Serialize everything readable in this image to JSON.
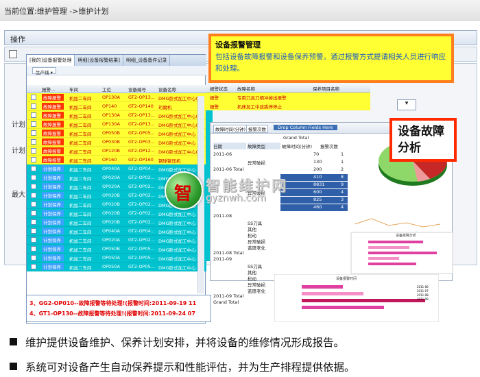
{
  "breadcrumb": "当前位置:维护管理 ->维护计划",
  "operations": {
    "label": "操作"
  },
  "left_labels": [
    "计划",
    "计划",
    "最大"
  ],
  "grid": {
    "tabs": [
      "[我的]设备报警处理",
      "明细[设备报警结果]",
      "明细_设备备件记录"
    ],
    "toolbar_button": "生产线 ▾",
    "headers": [
      "报警...",
      "车间",
      "工位",
      "设备编号",
      "设备名称",
      "报警状态",
      "故障名称",
      "保养项目名称"
    ],
    "rows": [
      {
        "type": "alarm",
        "tag": "故障报警",
        "workshop": "机加二车间",
        "station": "OP130A",
        "device_no": "GT2-OP13...",
        "device_name": "DMG卧式加工中心(精)"
      },
      {
        "type": "alarm",
        "tag": "故障报警",
        "workshop": "机加二车间",
        "station": "OP140",
        "device_no": "GT2-OP140",
        "device_name": "珩磨机"
      },
      {
        "type": "alarm",
        "tag": "故障报警",
        "workshop": "机加二车间",
        "station": "OP130A",
        "device_no": "GT2-OP13...",
        "device_name": "DMG卧式加工中心(精)"
      },
      {
        "type": "alarm",
        "tag": "故障报警",
        "workshop": "机加二车间",
        "station": "OP130A",
        "device_no": "GT2-OP13...",
        "device_name": "DMG卧式加工中心(精)"
      },
      {
        "type": "alarm",
        "tag": "故障报警",
        "workshop": "机加二车间",
        "station": "OP050B",
        "device_no": "GT2-OP05...",
        "device_name": "DMG卧式加工中心"
      },
      {
        "type": "alarm",
        "tag": "故障报警",
        "workshop": "机加二车间",
        "station": "OP030B",
        "device_no": "GT2-OP03...",
        "device_name": "DMG卧式加工中心"
      },
      {
        "type": "alarm",
        "tag": "故障报警",
        "workshop": "机加二车间",
        "station": "OP120B",
        "device_no": "GT2-OP12...",
        "device_name": "DMG卧式加工中心(精)"
      },
      {
        "type": "alarm",
        "tag": "故障报警",
        "workshop": "机加二车间",
        "station": "OP160",
        "device_no": "GT2-OP160",
        "device_name": "钢球铆压机"
      },
      {
        "type": "plan",
        "tag": "计划保养",
        "workshop": "机加二车间",
        "station": "OP040A",
        "device_no": "GT2-OP04...",
        "device_name": "DMG卧式加工中心"
      },
      {
        "type": "plan",
        "tag": "计划保养",
        "workshop": "机加二车间",
        "station": "OP020A",
        "device_no": "GT2-OP02...",
        "device_name": "DMG卧式加工中心"
      },
      {
        "type": "plan",
        "tag": "计划保养",
        "workshop": "机加二车间",
        "station": "OP020A",
        "device_no": "GT2-OP02...",
        "device_name": "DMG卧式加工中心"
      },
      {
        "type": "plan",
        "tag": "计划保养",
        "workshop": "机加二车间",
        "station": "OP020B",
        "device_no": "GT2-OP02...",
        "device_name": "DMG卧式加工中心"
      },
      {
        "type": "plan",
        "tag": "计划保养",
        "workshop": "机加二车间",
        "station": "OP020B",
        "device_no": "GT2-OP02...",
        "device_name": "DMG卧式加工中心"
      },
      {
        "type": "plan",
        "tag": "计划保养",
        "workshop": "机加二车间",
        "station": "OP020B",
        "device_no": "GT2-OP02...",
        "device_name": "DMG卧式加工中心"
      },
      {
        "type": "plan",
        "tag": "计划保养",
        "workshop": "机加二车间",
        "station": "OP020B",
        "device_no": "GT2-OP02...",
        "device_name": "DMG卧式加工中心"
      },
      {
        "type": "plan",
        "tag": "计划保养",
        "workshop": "机加二车间",
        "station": "OP040A",
        "device_no": "GT2-OP04...",
        "device_name": "DMG卧式加工中心"
      },
      {
        "type": "plan",
        "tag": "计划保养",
        "workshop": "机加二车间",
        "station": "OP020A",
        "device_no": "GT2-OP02...",
        "device_name": "DMG卧式加工中心"
      },
      {
        "type": "plan",
        "tag": "计划保养",
        "workshop": "机加二车间",
        "station": "OP050B",
        "device_no": "GT2-OP05...",
        "device_name": "DMG卧式加工中心"
      },
      {
        "type": "plan",
        "tag": "计划保养",
        "workshop": "机加二车间",
        "station": "OP050A",
        "device_no": "GT2-OP05...",
        "device_name": "DMG卧式加工中心"
      },
      {
        "type": "plan",
        "tag": "计划保养",
        "workshop": "机加二车间",
        "station": "OP050A",
        "device_no": "GT2-OP05...",
        "device_name": "DMG卧式加工中心"
      }
    ],
    "ext_rows": [
      {
        "status": "报警",
        "fault": "专用刀具刀柄冲掉出报警"
      },
      {
        "status": "报警",
        "fault": "机床加工中途跳停停止"
      }
    ]
  },
  "alarm_messages": [
    "3、GG2-OP010--故障报警等待处理!(报警时间:2011-09-19 11",
    "4、GT1-OP130--故障报警等待处理!(报警时间:2011-09-24 07"
  ],
  "callout_alarm": {
    "title": "设备报警管理",
    "desc": "包括设备故障报警和设备保养预警。通过报警方式提请相关人员进行响应和处理。"
  },
  "callout_analysis": {
    "line1": "设备故障",
    "line2": "分析"
  },
  "report": {
    "filter_buttons": [
      "故障时间(分钟)",
      "报警次数"
    ],
    "drop_zone": "Drop Column Fields Here",
    "grand_total": "Grand Total",
    "pivot_headers": [
      "日期",
      "故障类型",
      "故障时间(分钟)",
      "报警次数"
    ],
    "pivot_rows": [
      {
        "date": "2011-06",
        "type": "",
        "minutes": "70",
        "count": "1"
      },
      {
        "date": "",
        "type": "异常破损",
        "minutes": "130",
        "count": "1"
      },
      {
        "date": "2011-06 Total",
        "type": "",
        "minutes": "200",
        "count": "2"
      },
      {
        "date": "",
        "type": "",
        "minutes": "410",
        "count": "8"
      },
      {
        "date": "",
        "type": "",
        "minutes": "8831",
        "count": "9"
      },
      {
        "date": "",
        "type": "异常破损",
        "minutes": "600",
        "count": "4"
      },
      {
        "date": "",
        "type": "",
        "minutes": "825",
        "count": "3"
      },
      {
        "date": "",
        "type": "",
        "minutes": "460",
        "count": "4"
      }
    ],
    "pivot_tree": [
      "2011-08",
      "SS刀具",
      "其他",
      "松动",
      "异常破损",
      "蓝度老化",
      "2011-08 Total",
      "2011-09",
      "SS刀具",
      "其他",
      "松动",
      "异常破损",
      "蓝度老化",
      "2011-09 Total",
      "Grand Total"
    ],
    "chart1_title": "设备故障分析",
    "chart2_title": "设备报警时间",
    "legend": [
      "2011-06",
      "2011-07",
      "2011-08",
      "2011-09"
    ]
  },
  "watermark": {
    "glyph": "智",
    "cn": "智能维护网",
    "en": "gyznwh.com"
  },
  "bullets": [
    "维护提供设备维护、保养计划安排，并将设备的维修情况形成报告。",
    "系统可对设备产生自动保养提示和性能评估，并为生产排程提供依据。"
  ],
  "colors": {
    "alarm_row": "#ffff33",
    "plan_row": "#00c3cf",
    "callout_border": "#ff7f1f",
    "callout2_border": "#ff2a00",
    "link_blue": "#1c5bbf"
  }
}
